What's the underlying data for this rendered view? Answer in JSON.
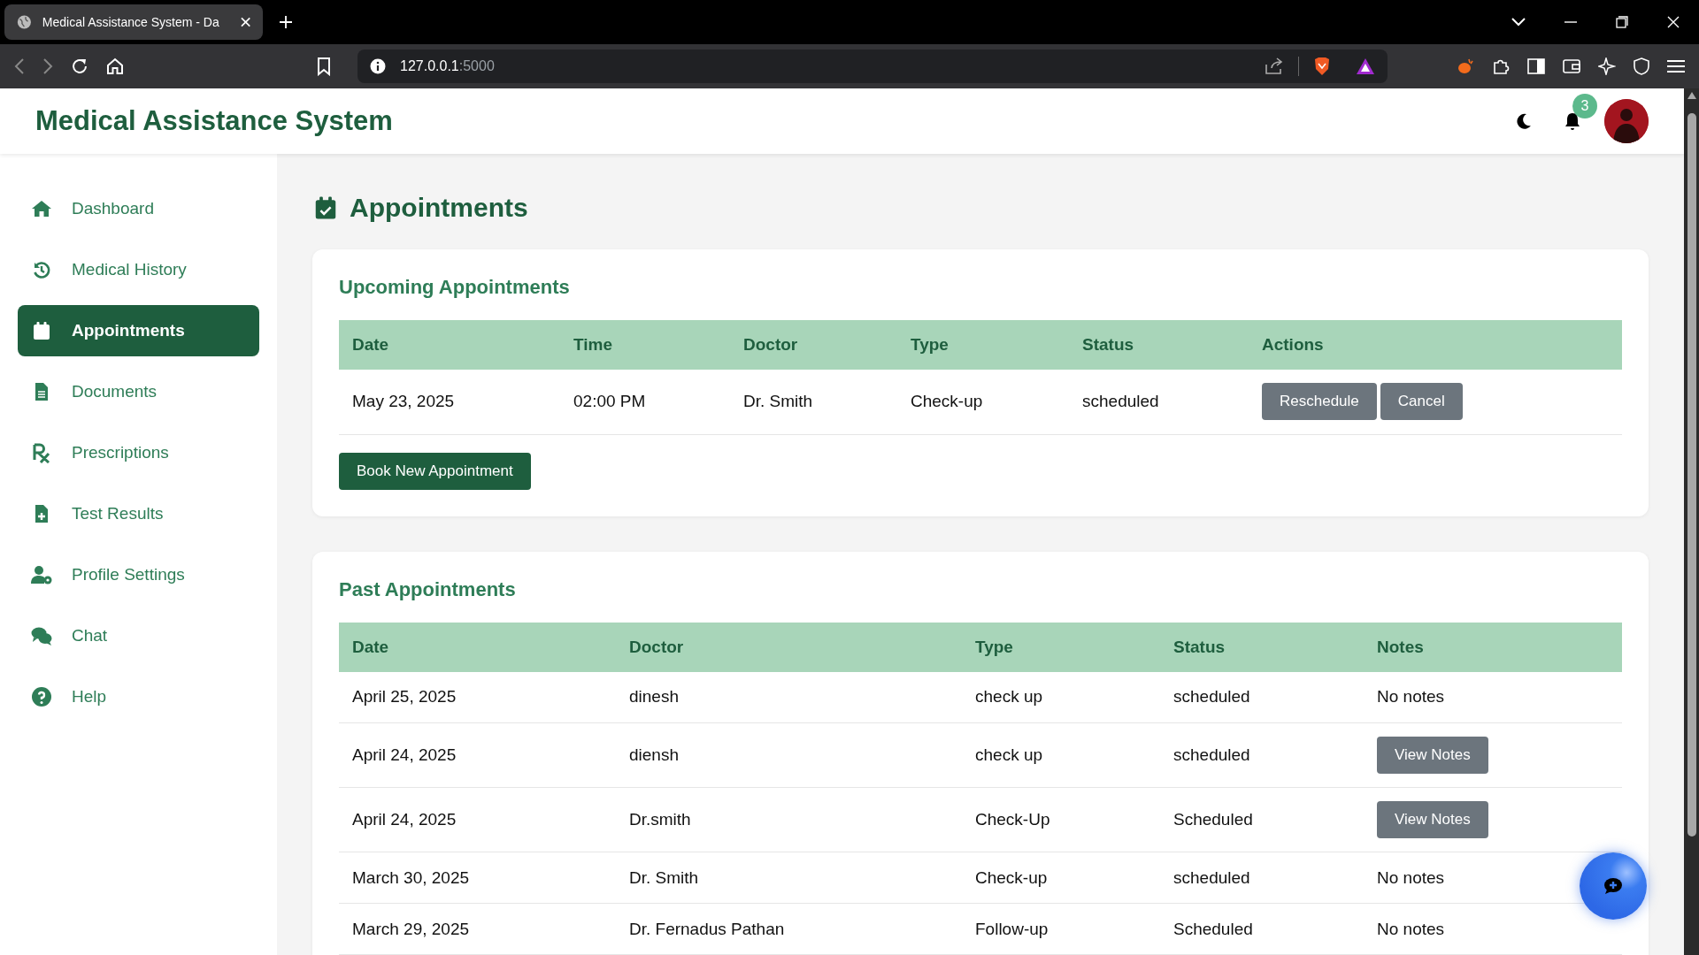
{
  "browser": {
    "tab_title": "Medical Assistance System - Da",
    "url_host": "127.0.0.1",
    "url_port": ":5000"
  },
  "header": {
    "title": "Medical Assistance System",
    "notification_count": "3"
  },
  "sidebar": {
    "items": [
      {
        "label": "Dashboard",
        "kind": "home",
        "selected": false
      },
      {
        "label": "Medical History",
        "kind": "history",
        "selected": false
      },
      {
        "label": "Appointments",
        "kind": "calendar",
        "selected": true
      },
      {
        "label": "Documents",
        "kind": "document",
        "selected": false
      },
      {
        "label": "Prescriptions",
        "kind": "rx",
        "selected": false
      },
      {
        "label": "Test Results",
        "kind": "file-plus",
        "selected": false
      },
      {
        "label": "Profile Settings",
        "kind": "user-gear",
        "selected": false
      },
      {
        "label": "Chat",
        "kind": "chat",
        "selected": false
      },
      {
        "label": "Help",
        "kind": "help",
        "selected": false
      }
    ]
  },
  "page_title": "Appointments",
  "upcoming": {
    "title": "Upcoming Appointments",
    "columns": [
      "Date",
      "Time",
      "Doctor",
      "Type",
      "Status",
      "Actions"
    ],
    "rows": [
      {
        "date": "May 23, 2025",
        "time": "02:00 PM",
        "doctor": "Dr. Smith",
        "type": "Check-up",
        "status": "scheduled",
        "actions": [
          "Reschedule",
          "Cancel"
        ]
      }
    ],
    "book_button": "Book New Appointment"
  },
  "past": {
    "title": "Past Appointments",
    "columns": [
      "Date",
      "Doctor",
      "Type",
      "Status",
      "Notes"
    ],
    "rows": [
      {
        "date": "April 25, 2025",
        "doctor": "dinesh",
        "type": "check up",
        "status": "scheduled",
        "notes": {
          "kind": "text",
          "label": "No notes"
        }
      },
      {
        "date": "April 24, 2025",
        "doctor": "diensh",
        "type": "check up",
        "status": "scheduled",
        "notes": {
          "kind": "button",
          "label": "View Notes"
        }
      },
      {
        "date": "April 24, 2025",
        "doctor": "Dr.smith",
        "type": "Check-Up",
        "status": "Scheduled",
        "notes": {
          "kind": "button",
          "label": "View Notes"
        }
      },
      {
        "date": "March 30, 2025",
        "doctor": "Dr. Smith",
        "type": "Check-up",
        "status": "scheduled",
        "notes": {
          "kind": "text",
          "label": "No notes"
        }
      },
      {
        "date": "March 29, 2025",
        "doctor": "Dr. Fernadus Pathan",
        "type": "Follow-up",
        "status": "Scheduled",
        "notes": {
          "kind": "text",
          "label": "No notes"
        }
      }
    ]
  }
}
